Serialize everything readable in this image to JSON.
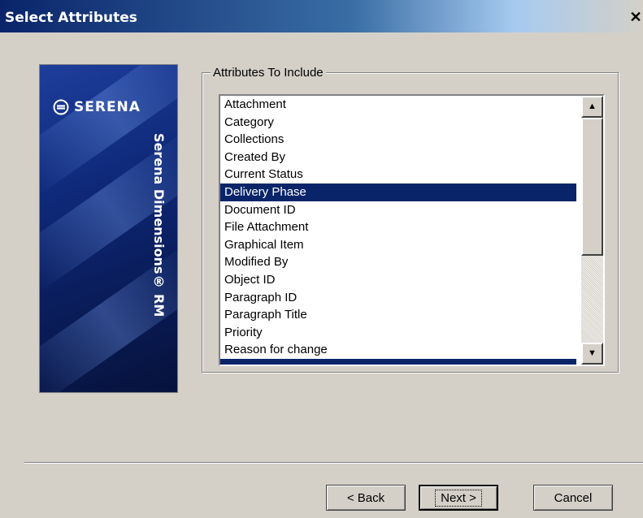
{
  "window": {
    "title": "Select Attributes",
    "close_glyph": "✕"
  },
  "banner": {
    "logo_text": "SERENA",
    "product_name": "Serena Dimensions® RM",
    "colors": {
      "background": "#0f2a7a",
      "text": "#ffffff"
    }
  },
  "attributes_group": {
    "label": "Attributes To Include",
    "items": [
      {
        "label": "Attachment",
        "selected": false
      },
      {
        "label": "Category",
        "selected": false
      },
      {
        "label": "Collections",
        "selected": false
      },
      {
        "label": "Created By",
        "selected": false
      },
      {
        "label": "Current Status",
        "selected": false
      },
      {
        "label": "Delivery Phase",
        "selected": true
      },
      {
        "label": "Document ID",
        "selected": false
      },
      {
        "label": "File Attachment",
        "selected": false
      },
      {
        "label": "Graphical Item",
        "selected": false
      },
      {
        "label": "Modified By",
        "selected": false
      },
      {
        "label": "Object ID",
        "selected": false
      },
      {
        "label": "Paragraph ID",
        "selected": false
      },
      {
        "label": "Paragraph Title",
        "selected": false
      },
      {
        "label": "Priority",
        "selected": false
      },
      {
        "label": "Reason for change",
        "selected": false
      },
      {
        "label": "",
        "selected": true
      }
    ],
    "scrollbar": {
      "up_icon": "▲",
      "down_icon": "▼"
    }
  },
  "buttons": {
    "back": "< Back",
    "next": "Next >",
    "cancel": "Cancel"
  },
  "colors": {
    "dialog_background": "#d4d0c8",
    "selection": "#0a246a",
    "titlebar_start": "#0a246a"
  }
}
